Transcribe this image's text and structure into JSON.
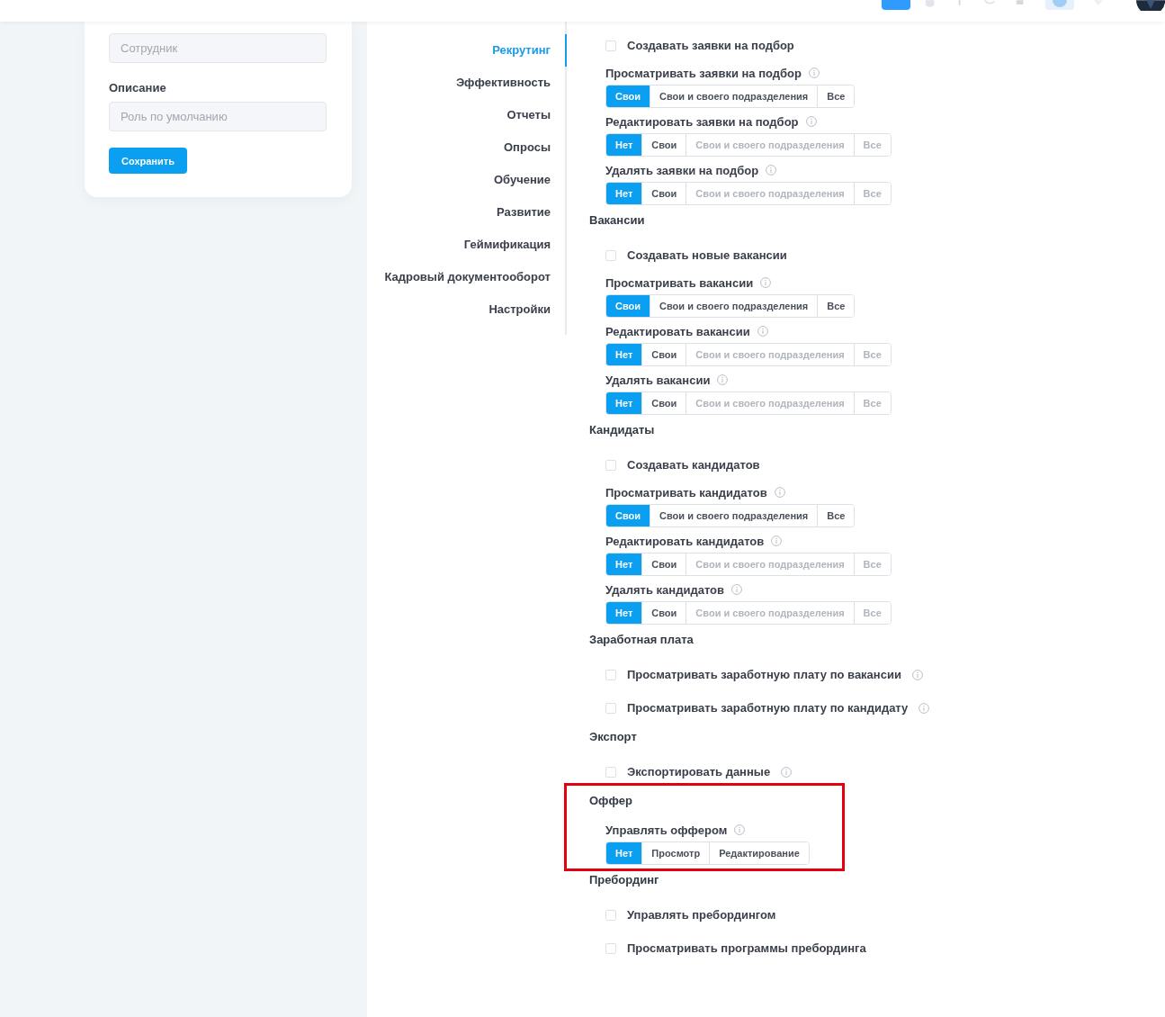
{
  "form": {
    "description_label": "Описание",
    "name_placeholder": "Сотрудник",
    "description_placeholder": "Роль по умолчанию",
    "save_button": "Сохранить"
  },
  "nav": [
    {
      "label": "Рекрутинг",
      "selected": true
    },
    {
      "label": "Эффективность",
      "selected": false
    },
    {
      "label": "Отчеты",
      "selected": false
    },
    {
      "label": "Опросы",
      "selected": false
    },
    {
      "label": "Обучение",
      "selected": false
    },
    {
      "label": "Развитие",
      "selected": false
    },
    {
      "label": "Геймификация",
      "selected": false
    },
    {
      "label": "Кадровый документооборот",
      "selected": false
    },
    {
      "label": "Настройки",
      "selected": false
    }
  ],
  "sections": [
    {
      "highlighted": false,
      "items": [
        {
          "kind": "checkbox",
          "label": "Создавать заявки на подбор",
          "checked": false,
          "info": false
        },
        {
          "kind": "segmented",
          "label": "Просматривать заявки на подбор",
          "options": [
            {
              "label": "Свои",
              "selected": true,
              "disabled": false
            },
            {
              "label": "Свои и своего подразделения",
              "selected": false,
              "disabled": false
            },
            {
              "label": "Все",
              "selected": false,
              "disabled": false
            }
          ]
        },
        {
          "kind": "segmented",
          "label": "Редактировать заявки на подбор",
          "options": [
            {
              "label": "Нет",
              "selected": true,
              "disabled": false
            },
            {
              "label": "Свои",
              "selected": false,
              "disabled": false
            },
            {
              "label": "Свои и своего подразделения",
              "selected": false,
              "disabled": true
            },
            {
              "label": "Все",
              "selected": false,
              "disabled": true
            }
          ]
        },
        {
          "kind": "segmented",
          "label": "Удалять заявки на подбор",
          "options": [
            {
              "label": "Нет",
              "selected": true,
              "disabled": false
            },
            {
              "label": "Свои",
              "selected": false,
              "disabled": false
            },
            {
              "label": "Свои и своего подразделения",
              "selected": false,
              "disabled": true
            },
            {
              "label": "Все",
              "selected": false,
              "disabled": true
            }
          ]
        }
      ]
    },
    {
      "title": "Вакансии",
      "highlighted": false,
      "items": [
        {
          "kind": "checkbox",
          "label": "Создавать новые вакансии",
          "checked": false,
          "info": false
        },
        {
          "kind": "segmented",
          "label": "Просматривать вакансии",
          "options": [
            {
              "label": "Свои",
              "selected": true,
              "disabled": false
            },
            {
              "label": "Свои и своего подразделения",
              "selected": false,
              "disabled": false
            },
            {
              "label": "Все",
              "selected": false,
              "disabled": false
            }
          ]
        },
        {
          "kind": "segmented",
          "label": "Редактировать вакансии",
          "options": [
            {
              "label": "Нет",
              "selected": true,
              "disabled": false
            },
            {
              "label": "Свои",
              "selected": false,
              "disabled": false
            },
            {
              "label": "Свои и своего подразделения",
              "selected": false,
              "disabled": true
            },
            {
              "label": "Все",
              "selected": false,
              "disabled": true
            }
          ]
        },
        {
          "kind": "segmented",
          "label": "Удалять вакансии",
          "options": [
            {
              "label": "Нет",
              "selected": true,
              "disabled": false
            },
            {
              "label": "Свои",
              "selected": false,
              "disabled": false
            },
            {
              "label": "Свои и своего подразделения",
              "selected": false,
              "disabled": true
            },
            {
              "label": "Все",
              "selected": false,
              "disabled": true
            }
          ]
        }
      ]
    },
    {
      "title": "Кандидаты",
      "highlighted": false,
      "items": [
        {
          "kind": "checkbox",
          "label": "Создавать кандидатов",
          "checked": false,
          "info": false
        },
        {
          "kind": "segmented",
          "label": "Просматривать кандидатов",
          "options": [
            {
              "label": "Свои",
              "selected": true,
              "disabled": false
            },
            {
              "label": "Свои и своего подразделения",
              "selected": false,
              "disabled": false
            },
            {
              "label": "Все",
              "selected": false,
              "disabled": false
            }
          ]
        },
        {
          "kind": "segmented",
          "label": "Редактировать кандидатов",
          "options": [
            {
              "label": "Нет",
              "selected": true,
              "disabled": false
            },
            {
              "label": "Свои",
              "selected": false,
              "disabled": false
            },
            {
              "label": "Свои и своего подразделения",
              "selected": false,
              "disabled": true
            },
            {
              "label": "Все",
              "selected": false,
              "disabled": true
            }
          ]
        },
        {
          "kind": "segmented",
          "label": "Удалять кандидатов",
          "options": [
            {
              "label": "Нет",
              "selected": true,
              "disabled": false
            },
            {
              "label": "Свои",
              "selected": false,
              "disabled": false
            },
            {
              "label": "Свои и своего подразделения",
              "selected": false,
              "disabled": true
            },
            {
              "label": "Все",
              "selected": false,
              "disabled": true
            }
          ]
        }
      ]
    },
    {
      "title": "Заработная плата",
      "highlighted": false,
      "items": [
        {
          "kind": "checkbox",
          "label": "Просматривать заработную плату по вакансии",
          "checked": false,
          "info": true
        },
        {
          "kind": "checkbox",
          "label": "Просматривать заработную плату по кандидату",
          "checked": false,
          "info": true
        }
      ]
    },
    {
      "title": "Экспорт",
      "highlighted": false,
      "items": [
        {
          "kind": "checkbox",
          "label": "Экспортировать данные",
          "checked": false,
          "info": true
        }
      ]
    },
    {
      "title": "Оффер",
      "highlighted": true,
      "items": [
        {
          "kind": "segmented",
          "label": "Управлять оффером",
          "options": [
            {
              "label": "Нет",
              "selected": true,
              "disabled": false
            },
            {
              "label": "Просмотр",
              "selected": false,
              "disabled": false
            },
            {
              "label": "Редактирование",
              "selected": false,
              "disabled": false
            }
          ]
        }
      ]
    },
    {
      "title": "Пребординг",
      "highlighted": false,
      "items": [
        {
          "kind": "checkbox",
          "label": "Управлять пребордингом",
          "checked": false,
          "info": false
        },
        {
          "kind": "checkbox",
          "label": "Просматривать программы пребординга",
          "checked": false,
          "info": false
        }
      ]
    }
  ]
}
